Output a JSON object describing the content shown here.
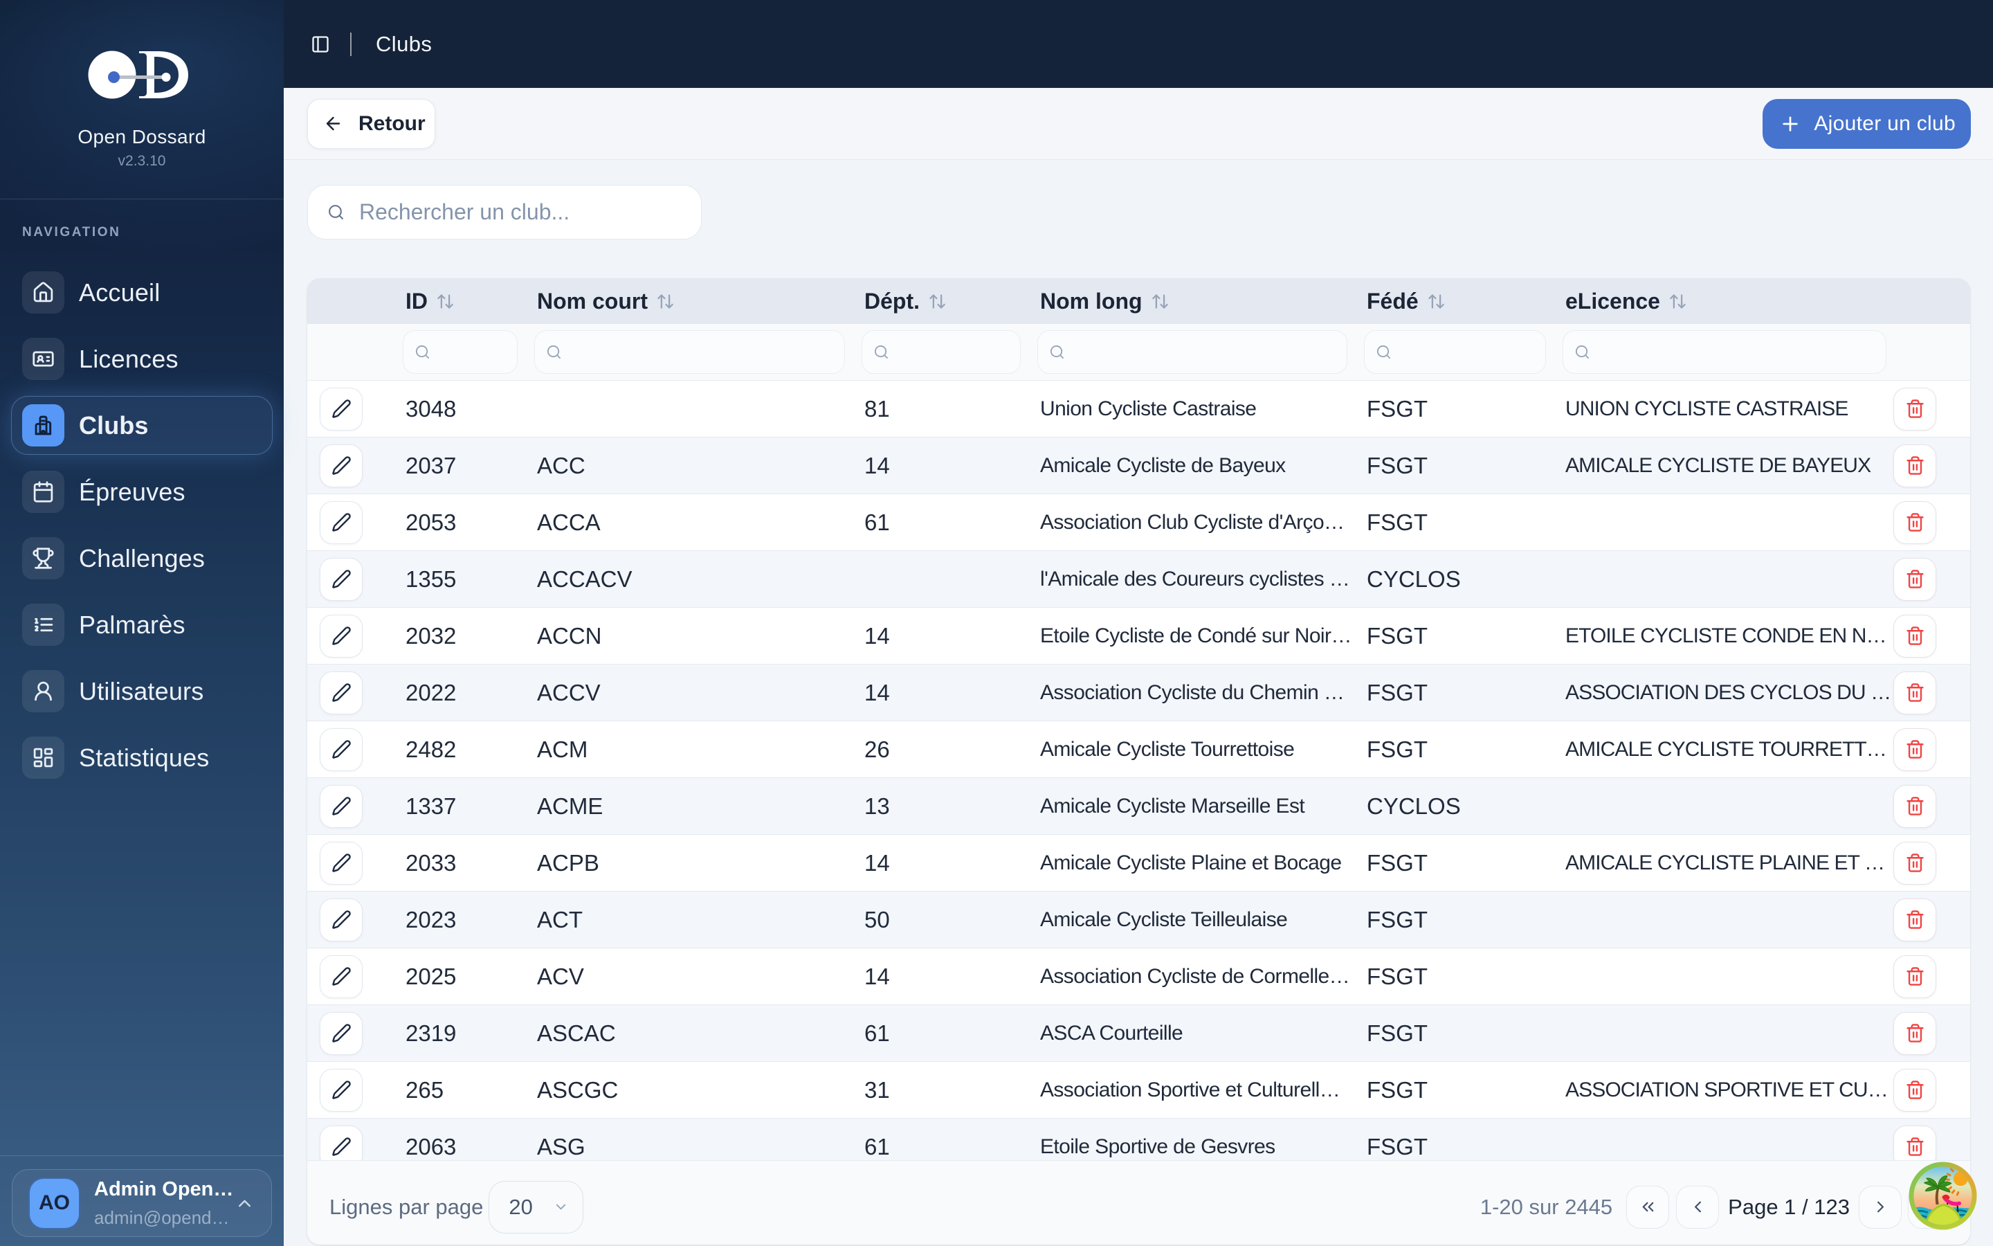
{
  "brand": {
    "name": "Open Dossard",
    "version": "v2.3.10"
  },
  "nav_section_label": "NAVIGATION",
  "nav": {
    "items": [
      {
        "id": "accueil",
        "label": "Accueil",
        "icon": "house-icon",
        "active": false
      },
      {
        "id": "licences",
        "label": "Licences",
        "icon": "id-card-icon",
        "active": false
      },
      {
        "id": "clubs",
        "label": "Clubs",
        "icon": "building-icon",
        "active": true
      },
      {
        "id": "epreuves",
        "label": "Épreuves",
        "icon": "calendar-icon",
        "active": false
      },
      {
        "id": "challenges",
        "label": "Challenges",
        "icon": "trophy-icon",
        "active": false
      },
      {
        "id": "palmares",
        "label": "Palmarès",
        "icon": "list-ordered-icon",
        "active": false
      },
      {
        "id": "utilisateurs",
        "label": "Utilisateurs",
        "icon": "user-icon",
        "active": false
      },
      {
        "id": "statistiques",
        "label": "Statistiques",
        "icon": "layout-dashboard-icon",
        "active": false
      }
    ]
  },
  "user": {
    "initials": "AO",
    "name": "Admin Open…",
    "email": "admin@opend…"
  },
  "topbar": {
    "title": "Clubs"
  },
  "toolbar": {
    "back_label": "Retour",
    "add_label": "Ajouter un club"
  },
  "search": {
    "placeholder": "Rechercher un club..."
  },
  "table": {
    "columns": [
      {
        "key": "id",
        "label": "ID"
      },
      {
        "key": "nomCourt",
        "label": "Nom court"
      },
      {
        "key": "dept",
        "label": "Dépt."
      },
      {
        "key": "nomLong",
        "label": "Nom long"
      },
      {
        "key": "fede",
        "label": "Fédé"
      },
      {
        "key": "elicence",
        "label": "eLicence"
      }
    ],
    "rows": [
      {
        "id": "3048",
        "nomCourt": "",
        "dept": "81",
        "nomLong": "Union Cycliste Castraise",
        "fede": "FSGT",
        "elicence": "UNION CYCLISTE CASTRAISE"
      },
      {
        "id": "2037",
        "nomCourt": "ACC",
        "dept": "14",
        "nomLong": "Amicale Cycliste de Bayeux",
        "fede": "FSGT",
        "elicence": "AMICALE CYCLISTE DE BAYEUX"
      },
      {
        "id": "2053",
        "nomCourt": "ACCA",
        "dept": "61",
        "nomLong": "Association Club Cycliste d'Arço…",
        "fede": "FSGT",
        "elicence": ""
      },
      {
        "id": "1355",
        "nomCourt": "ACCACV",
        "dept": "",
        "nomLong": "l'Amicale des Coureurs cyclistes …",
        "fede": "CYCLOS",
        "elicence": ""
      },
      {
        "id": "2032",
        "nomCourt": "ACCN",
        "dept": "14",
        "nomLong": "Etoile Cycliste de Condé sur Noir…",
        "fede": "FSGT",
        "elicence": "ETOILE CYCLISTE CONDE EN N…"
      },
      {
        "id": "2022",
        "nomCourt": "ACCV",
        "dept": "14",
        "nomLong": "Association Cycliste du Chemin …",
        "fede": "FSGT",
        "elicence": "ASSOCIATION DES CYCLOS DU …"
      },
      {
        "id": "2482",
        "nomCourt": "ACM",
        "dept": "26",
        "nomLong": "Amicale Cycliste Tourrettoise",
        "fede": "FSGT",
        "elicence": "AMICALE CYCLISTE TOURRETT…"
      },
      {
        "id": "1337",
        "nomCourt": "ACME",
        "dept": "13",
        "nomLong": "Amicale Cycliste Marseille Est",
        "fede": "CYCLOS",
        "elicence": ""
      },
      {
        "id": "2033",
        "nomCourt": "ACPB",
        "dept": "14",
        "nomLong": "Amicale Cycliste Plaine et Bocage",
        "fede": "FSGT",
        "elicence": "AMICALE CYCLISTE PLAINE ET …"
      },
      {
        "id": "2023",
        "nomCourt": "ACT",
        "dept": "50",
        "nomLong": "Amicale Cycliste Teilleulaise",
        "fede": "FSGT",
        "elicence": ""
      },
      {
        "id": "2025",
        "nomCourt": "ACV",
        "dept": "14",
        "nomLong": "Association Cycliste de Cormelle…",
        "fede": "FSGT",
        "elicence": ""
      },
      {
        "id": "2319",
        "nomCourt": "ASCAC",
        "dept": "61",
        "nomLong": "ASCA Courteille",
        "fede": "FSGT",
        "elicence": ""
      },
      {
        "id": "265",
        "nomCourt": "ASCGC",
        "dept": "31",
        "nomLong": "Association Sportive et Culturell…",
        "fede": "FSGT",
        "elicence": "ASSOCIATION SPORTIVE ET CU…"
      },
      {
        "id": "2063",
        "nomCourt": "ASG",
        "dept": "61",
        "nomLong": "Etoile Sportive de Gesvres",
        "fede": "FSGT",
        "elicence": ""
      }
    ]
  },
  "footer": {
    "rows_per_page_label": "Lignes par page",
    "rows_per_page_value": "20",
    "range_info": "1-20 sur 2445",
    "page_label": "Page 1 / 123"
  },
  "icons": {
    "sidebar_toggle": "panel-left-icon",
    "back_button": "arrow-left-icon",
    "add_button": "plus-icon",
    "search": "search-icon",
    "column_sort": "arrow-up-down-icon",
    "row_edit": "pencil-icon",
    "row_delete": "trash-icon",
    "rows_per_page": "chevron-down-icon",
    "user_menu": "chevron-up-icon",
    "page_first": "chevrons-left-icon",
    "page_previous": "chevron-left-icon",
    "page_next": "chevron-right-icon",
    "page_last": "chevrons-right-icon",
    "floating_widget": "beach-island-icon"
  },
  "colors": {
    "accent_blue": "#4673cd",
    "active_tile_blue": "#5797f6",
    "avatar_blue": "#62a2f8",
    "danger_red": "#ef4444",
    "header_navy": "#142339"
  }
}
